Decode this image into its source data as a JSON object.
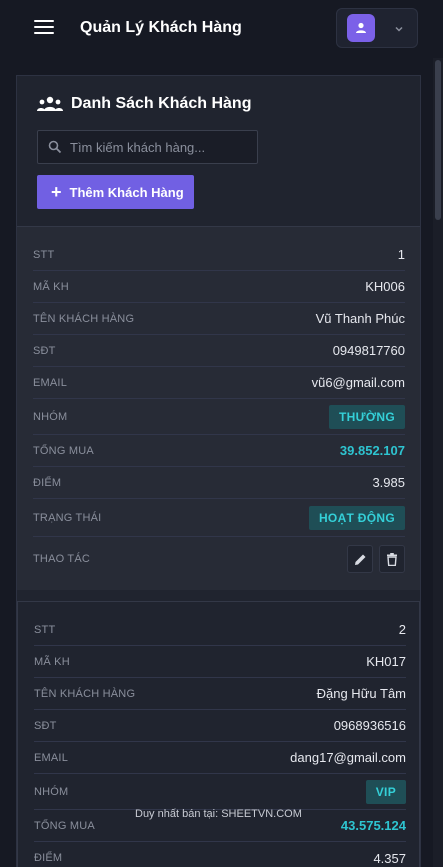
{
  "header": {
    "title": "Quản Lý Khách Hàng",
    "menu_icon": "hamburger-icon",
    "user_icon": "user-avatar-icon",
    "accent": "#7b61e8"
  },
  "panel": {
    "title": "Danh Sách Khách Hàng",
    "search_placeholder": "Tìm kiếm khách hàng...",
    "add_label": "Thêm Khách Hàng"
  },
  "customers": [
    {
      "fields": [
        {
          "label": "STT",
          "value": "1"
        },
        {
          "label": "MÃ KH",
          "value": "KH006"
        },
        {
          "label": "TÊN KHÁCH HÀNG",
          "value": "Vũ Thanh Phúc"
        },
        {
          "label": "SĐT",
          "value": "0949817760"
        },
        {
          "label": "EMAIL",
          "value": "vũ6@gmail.com"
        },
        {
          "label": "NHÓM",
          "value": "THƯỜNG"
        },
        {
          "label": "TỔNG MUA",
          "value": "39.852.107"
        },
        {
          "label": "ĐIỂM",
          "value": "3.985"
        },
        {
          "label": "TRẠNG THÁI",
          "value": "HOẠT ĐỘNG"
        },
        {
          "label": "THAO TÁC",
          "value": ""
        }
      ]
    },
    {
      "fields": [
        {
          "label": "STT",
          "value": "2"
        },
        {
          "label": "MÃ KH",
          "value": "KH017"
        },
        {
          "label": "TÊN KHÁCH HÀNG",
          "value": "Đặng Hữu Tâm"
        },
        {
          "label": "SĐT",
          "value": "0968936516"
        },
        {
          "label": "EMAIL",
          "value": "dang17@gmail.com"
        },
        {
          "label": "NHÓM",
          "value": "VIP"
        },
        {
          "label": "TỔNG MUA",
          "value": "43.575.124"
        },
        {
          "label": "ĐIỂM",
          "value": "4.357"
        }
      ]
    }
  ],
  "watermark": "Duy nhất bán tại: SHEETVN.COM"
}
